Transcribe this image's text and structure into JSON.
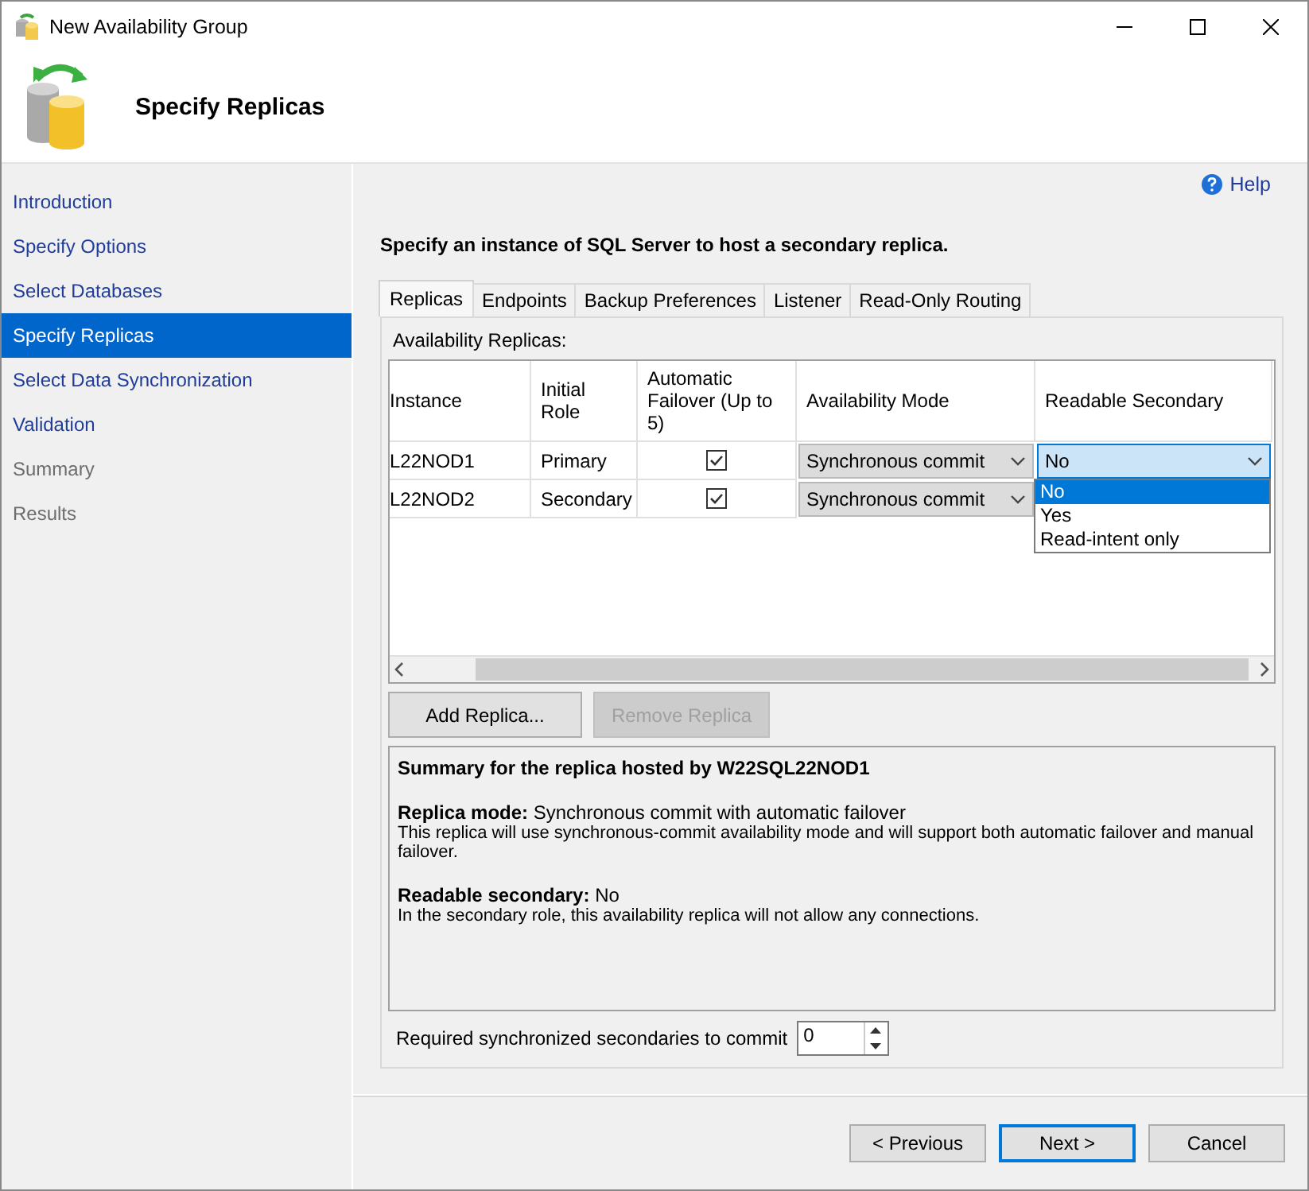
{
  "window": {
    "title": "New Availability Group"
  },
  "header": {
    "title": "Specify Replicas"
  },
  "sidebar": {
    "items": [
      {
        "label": "Introduction",
        "enabled": true,
        "selected": false
      },
      {
        "label": "Specify Options",
        "enabled": true,
        "selected": false
      },
      {
        "label": "Select Databases",
        "enabled": true,
        "selected": false
      },
      {
        "label": "Specify Replicas",
        "enabled": true,
        "selected": true
      },
      {
        "label": "Select Data Synchronization",
        "enabled": true,
        "selected": false
      },
      {
        "label": "Validation",
        "enabled": true,
        "selected": false
      },
      {
        "label": "Summary",
        "enabled": false,
        "selected": false
      },
      {
        "label": "Results",
        "enabled": false,
        "selected": false
      }
    ]
  },
  "help": "Help",
  "instruction": "Specify an instance of SQL Server to host a secondary replica.",
  "tabs": [
    {
      "label": "Replicas",
      "selected": true
    },
    {
      "label": "Endpoints",
      "selected": false
    },
    {
      "label": "Backup Preferences",
      "selected": false
    },
    {
      "label": "Listener",
      "selected": false
    },
    {
      "label": "Read-Only Routing",
      "selected": false
    }
  ],
  "replicas": {
    "label": "Availability Replicas:",
    "columns": [
      "Instance",
      "Initial Role",
      "Automatic Failover (Up to 5)",
      "Availability Mode",
      "Readable Secondary"
    ],
    "rows": [
      {
        "instance": "L22NOD1",
        "role": "Primary",
        "automatic_failover": true,
        "availability_mode": "Synchronous commit",
        "readable_secondary": {
          "value": "No",
          "focused": true
        }
      },
      {
        "instance": "L22NOD2",
        "role": "Secondary",
        "automatic_failover": true,
        "availability_mode": "Synchronous commit"
      }
    ],
    "dropdown_options": [
      {
        "label": "No",
        "selected": true
      },
      {
        "label": "Yes",
        "selected": false
      },
      {
        "label": "Read-intent only",
        "selected": false
      }
    ]
  },
  "buttons": [
    {
      "label": "Add Replica...",
      "disabled": false
    },
    {
      "label": "Remove Replica",
      "disabled": true
    }
  ],
  "summary": {
    "title": "Summary for the replica hosted by W22SQL22NOD1",
    "sections": [
      {
        "label": "Replica mode:",
        "value": "Synchronous commit with automatic failover",
        "description": "This replica will use synchronous-commit availability mode and will support both automatic failover and manual failover."
      },
      {
        "label": "Readable secondary:",
        "value": "No",
        "description": "In the secondary role, this availability replica will not allow any connections."
      }
    ]
  },
  "required_secondaries": {
    "label": "Required synchronized secondaries to commit",
    "value": "0"
  },
  "footer_buttons": [
    {
      "label": "< Previous",
      "default": false
    },
    {
      "label": "Next >",
      "default": true
    },
    {
      "label": "Cancel",
      "default": false
    }
  ]
}
